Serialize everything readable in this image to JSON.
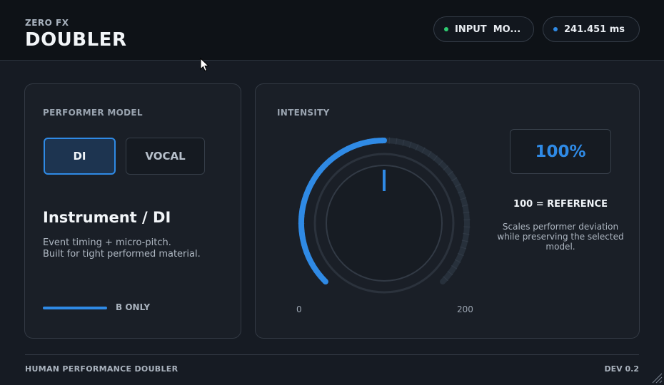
{
  "header": {
    "brand_sub": "ZERO FX",
    "brand_title": "DOUBLER",
    "input_status": {
      "label": "INPUT  MO...",
      "dot_color": "#2ecc71"
    },
    "latency": {
      "label": "241.451 ms",
      "dot_color": "#2f8ae5"
    }
  },
  "performer": {
    "section_label": "PERFORMER MODEL",
    "buttons": [
      {
        "label": "DI",
        "active": true
      },
      {
        "label": "VOCAL",
        "active": false
      }
    ],
    "model_name": "Instrument / DI",
    "description_line1": "Event timing + micro-pitch.",
    "description_line2": "Built for tight performed material.",
    "monitor_label": "B ONLY"
  },
  "intensity": {
    "section_label": "INTENSITY",
    "value": 100,
    "min": 0,
    "max": 200,
    "display": "100%",
    "scale_min_label": "0",
    "scale_max_label": "200",
    "reference_label": "100 = REFERENCE",
    "description_line1": "Scales performer deviation",
    "description_line2": "while preserving the selected",
    "description_line3": "model."
  },
  "footer": {
    "left": "HUMAN PERFORMANCE DOUBLER",
    "right": "DEV 0.2"
  },
  "colors": {
    "accent": "#2f8ae5",
    "ok": "#2ecc71"
  },
  "icons": {
    "cursor": "mouse-pointer-icon",
    "resize": "resize-grip-icon"
  }
}
